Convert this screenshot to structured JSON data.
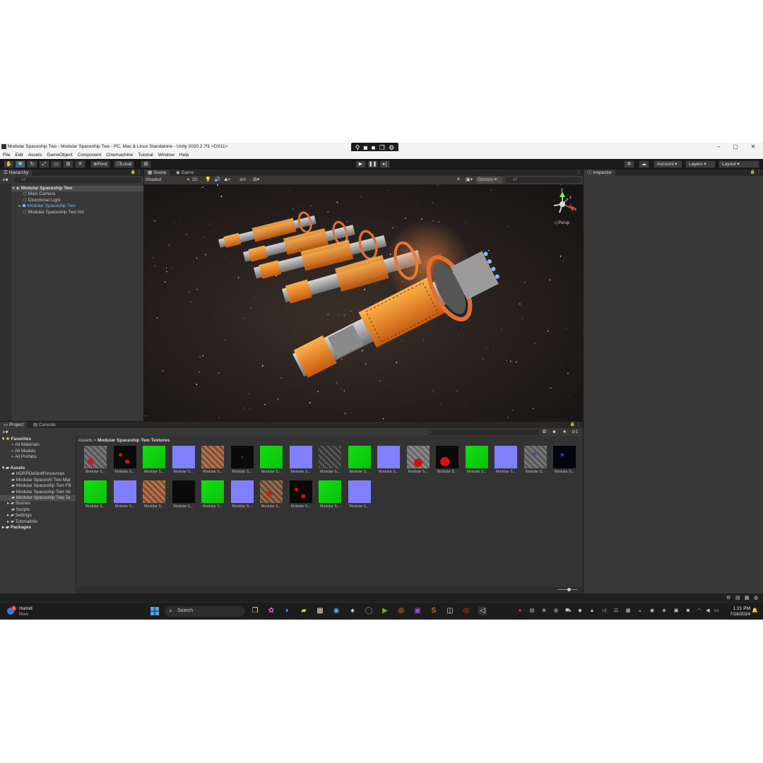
{
  "window": {
    "title": "Modular Spaceship Two - Modular Spaceship Two - PC, Mac & Linux Standalone - Unity 2020.2.7f1 <DX11>",
    "controls": {
      "minimize": "–",
      "maximize": "▢",
      "close": "✕"
    }
  },
  "capture_bar": {
    "icons": [
      "pin-icon",
      "camera-icon",
      "video-icon",
      "multi-window-icon",
      "gear-icon"
    ]
  },
  "menu": [
    "File",
    "Edit",
    "Assets",
    "GameObject",
    "Component",
    "Cinemachine",
    "Tutorial",
    "Window",
    "Help"
  ],
  "toolbar": {
    "pivot_label": "Pivot",
    "local_label": "Local",
    "account_label": "Account",
    "layers_label": "Layers",
    "layout_label": "Layout"
  },
  "hierarchy": {
    "tab_label": "Hierarchy",
    "search_placeholder": "All",
    "items": [
      {
        "label": "Modular Spaceship Two",
        "depth": 0,
        "expanded": true,
        "selected": false,
        "icon": "unity-scene-icon"
      },
      {
        "label": "Main Camera",
        "depth": 1,
        "icon": "gameobject-icon"
      },
      {
        "label": "Directional Light",
        "depth": 1,
        "icon": "gameobject-icon"
      },
      {
        "label": "Modular Spaceship Two",
        "depth": 1,
        "icon": "prefab-icon",
        "prefab": true
      },
      {
        "label": "Modular Spaceship Two Vol",
        "depth": 1,
        "icon": "gameobject-icon"
      }
    ]
  },
  "scene": {
    "tabs": [
      {
        "label": "Scene",
        "active": true
      },
      {
        "label": "Game",
        "active": false
      }
    ],
    "draw_mode": "Shaded",
    "mode_2d": "2D",
    "layers_count": "0",
    "gizmos_label": "Gizmos",
    "search_placeholder": "All",
    "axis_labels": {
      "y": "y",
      "x": "x",
      "z": "z"
    },
    "projection_label": "◁ Persp"
  },
  "inspector": {
    "tab_label": "Inspector"
  },
  "project": {
    "tabs": [
      {
        "label": "Project",
        "active": true
      },
      {
        "label": "Console",
        "active": false
      }
    ],
    "favorites": {
      "label": "Favorites",
      "items": [
        "All Materials",
        "All Models",
        "All Prefabs"
      ]
    },
    "assets": {
      "label": "Assets",
      "items": [
        {
          "label": "HDRPDefaultResources",
          "selected": false
        },
        {
          "label": "Modular Spaceshi Two Mat",
          "selected": false
        },
        {
          "label": "Modular Spaceship Two FB",
          "selected": false
        },
        {
          "label": "Modular Spaceship Two Sk",
          "selected": false
        },
        {
          "label": "Modular Spaceship Two Te",
          "selected": true
        },
        {
          "label": "Scenes",
          "selected": false
        },
        {
          "label": "Scripts",
          "selected": false
        },
        {
          "label": "Settings",
          "selected": false
        },
        {
          "label": "TutorialInfo",
          "selected": false
        }
      ]
    },
    "packages_label": "Packages",
    "breadcrumb": {
      "root": "Assets",
      "separator": ">",
      "current": "Modular Spaceship Two Textures"
    },
    "hidden_count": "1",
    "textures": [
      {
        "label": "Modular S...",
        "kind": "gray-red"
      },
      {
        "label": "Modular S...",
        "kind": "black-red"
      },
      {
        "label": "Modular S...",
        "kind": "green"
      },
      {
        "label": "Modular S...",
        "kind": "normal"
      },
      {
        "label": "Modular S...",
        "kind": "orange-albedo"
      },
      {
        "label": "Modular S...",
        "kind": "black-red-sparse"
      },
      {
        "label": "Modular S...",
        "kind": "green"
      },
      {
        "label": "Modular S...",
        "kind": "normal"
      },
      {
        "label": "Modular S...",
        "kind": "gray-dark"
      },
      {
        "label": "Modular S...",
        "kind": "green"
      },
      {
        "label": "Modular S...",
        "kind": "normal"
      },
      {
        "label": "Modular S...",
        "kind": "gray-red-big"
      },
      {
        "label": "Modular S...",
        "kind": "black-red-big"
      },
      {
        "label": "Modular S...",
        "kind": "green"
      },
      {
        "label": "Modular S...",
        "kind": "normal"
      },
      {
        "label": "Modular S...",
        "kind": "gray-blue"
      },
      {
        "label": "Modular S...",
        "kind": "black-blue"
      },
      {
        "label": "Modular S...",
        "kind": "green"
      },
      {
        "label": "Modular S...",
        "kind": "normal"
      },
      {
        "label": "Modular S...",
        "kind": "orange-albedo"
      },
      {
        "label": "Modular S...",
        "kind": "black"
      },
      {
        "label": "Modular S...",
        "kind": "green"
      },
      {
        "label": "Modular S...",
        "kind": "normal"
      },
      {
        "label": "Modular S...",
        "kind": "orange-red"
      },
      {
        "label": "Modular S...",
        "kind": "black-red"
      },
      {
        "label": "Modular S...",
        "kind": "green"
      },
      {
        "label": "Modular S...",
        "kind": "normal"
      }
    ]
  },
  "taskbar": {
    "notification": {
      "title": "Humid",
      "subtitle": "Now",
      "badge": "1"
    },
    "search_label": "Search",
    "time": "1:21 PM",
    "date": "7/16/2024"
  },
  "colors": {
    "accent_blue": "#46607c",
    "prefab_blue": "#7cb3ff",
    "texture_green": "#10e010",
    "normal_map": "#8080ff"
  }
}
